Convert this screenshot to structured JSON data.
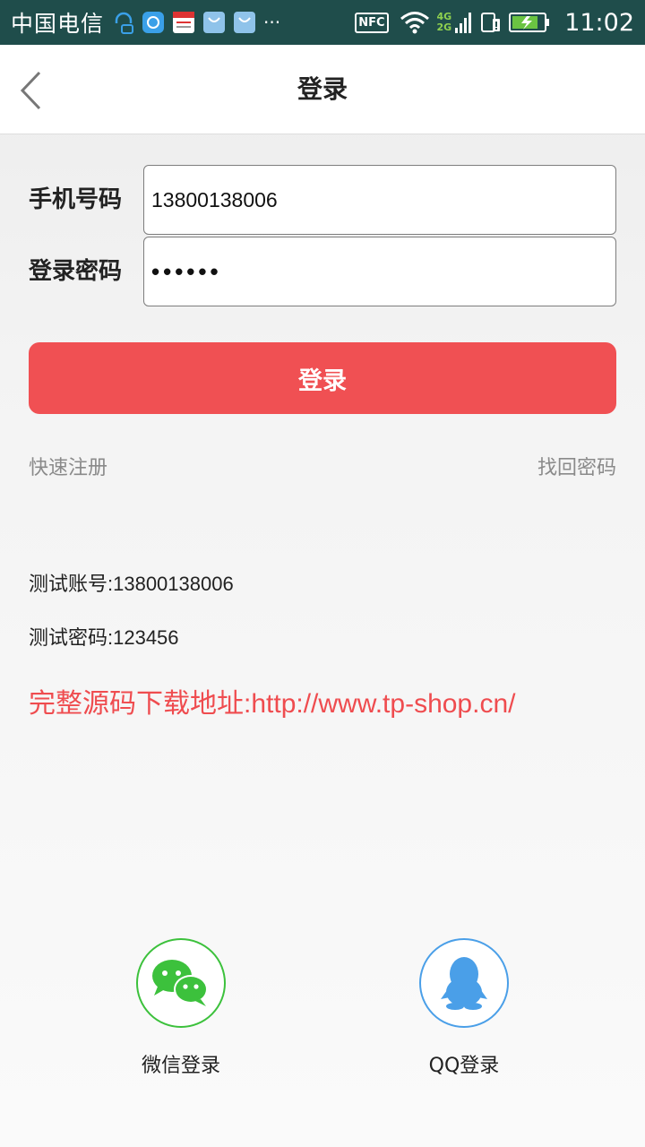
{
  "status_bar": {
    "carrier": "中国电信",
    "overflow": "···",
    "nfc": "NFC",
    "network_top": "4G",
    "network_bottom": "2G",
    "time": "11:02"
  },
  "header": {
    "title": "登录"
  },
  "form": {
    "phone_label": "手机号码",
    "phone_value": "13800138006",
    "password_label": "登录密码",
    "password_value": "••••••"
  },
  "login_button": "登录",
  "links": {
    "register": "快速注册",
    "forgot": "找回密码"
  },
  "info": {
    "test_account": "测试账号:13800138006",
    "test_password": "测试密码:123456",
    "promo": "完整源码下载地址:http://www.tp-shop.cn/"
  },
  "social": {
    "wechat_label": "微信登录",
    "qq_label": "QQ登录"
  },
  "colors": {
    "accent": "#f05053",
    "wechat": "#3cc13c",
    "qq": "#4a9fe8",
    "status_bar": "#1f4d4b"
  }
}
